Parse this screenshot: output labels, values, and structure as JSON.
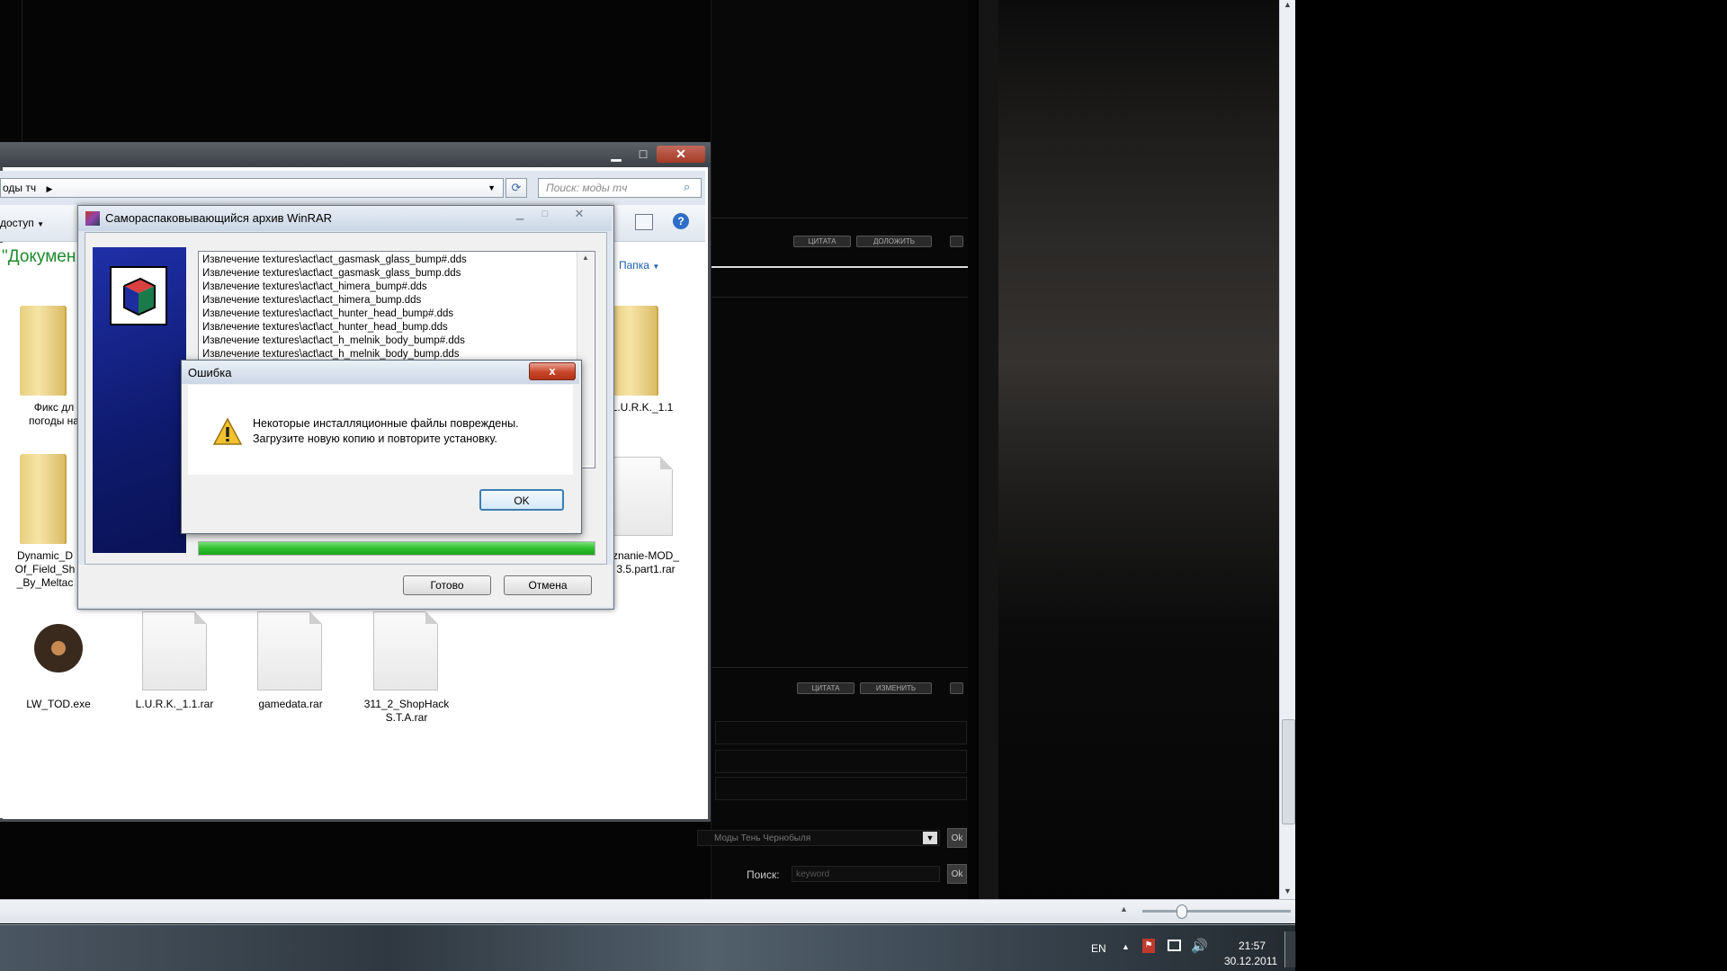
{
  "forum": {
    "quote_label": "ЦИТАТА",
    "report_label": "ДОЛОЖИТЬ",
    "edit_label": "ИЗМЕНИТЬ",
    "forum_select": "Моды Тень Чернобыля",
    "ok_label": "Ok",
    "search_label": "Поиск:",
    "search_placeholder": "keyword"
  },
  "taskbar": {
    "language": "EN",
    "time": "21:57",
    "date": "30.12.2011"
  },
  "explorer": {
    "breadcrumb": "оды тч",
    "search_placeholder": "Поиск: моды тч",
    "share_menu": "доступ",
    "folder_heading": "\"Докумен",
    "new_folder_button": "Папка",
    "items": [
      {
        "label": "Фикс дл\nпогоды на"
      },
      {
        "label": "L.U.R.K._1.1"
      },
      {
        "label": "Dynamic_D\nOf_Field_Sh\n_By_Meltac"
      },
      {
        "label": "znanie-MOD_\n3.5.part1.rar"
      },
      {
        "label": "LW_TOD.exe"
      },
      {
        "label": "L.U.R.K._1.1.rar"
      },
      {
        "label": "gamedata.rar"
      },
      {
        "label": "311_2_ShopHack\nS.T.A.rar"
      }
    ]
  },
  "winrar": {
    "title": "Самораспаковывающийся архив WinRAR",
    "log_lines": [
      "Извлечение textures\\act\\act_gasmask_glass_bump#.dds",
      "Извлечение textures\\act\\act_gasmask_glass_bump.dds",
      "Извлечение textures\\act\\act_himera_bump#.dds",
      "Извлечение textures\\act\\act_himera_bump.dds",
      "Извлечение textures\\act\\act_hunter_head_bump#.dds",
      "Извлечение textures\\act\\act_hunter_head_bump.dds",
      "Извлечение textures\\act\\act_h_melnik_body_bump#.dds",
      "Извлечение textures\\act\\act_h_melnik_body_bump.dds"
    ],
    "progress": 1.0,
    "done_button": "Готово",
    "cancel_button": "Отмена"
  },
  "error_dialog": {
    "title": "Ошибка",
    "message_line1": "Некоторые инсталляционные файлы повреждены.",
    "message_line2": "Загрузите новую копию и повторите установку.",
    "ok_button": "OK",
    "close_glyph": "x"
  },
  "colors": {
    "progress_green": "#2fbf2f",
    "folder_heading_green": "#1e8a2e",
    "link_blue": "#1a5fb4"
  }
}
